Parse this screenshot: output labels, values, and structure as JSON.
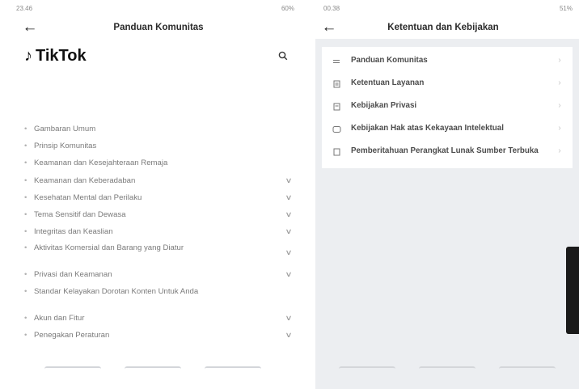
{
  "left": {
    "status": {
      "time": "23.46",
      "right": "60%"
    },
    "title": "Panduan Komunitas",
    "brand": "TikTok",
    "nav_items": [
      {
        "label": "Gambaran Umum",
        "expandable": false
      },
      {
        "label": "Prinsip Komunitas",
        "expandable": false
      },
      {
        "label": "Keamanan dan Kesejahteraan Remaja",
        "expandable": false
      },
      {
        "label": "Keamanan dan Keberadaban",
        "expandable": true
      },
      {
        "label": "Kesehatan Mental dan Perilaku",
        "expandable": true
      },
      {
        "label": "Tema Sensitif dan Dewasa",
        "expandable": true
      },
      {
        "label": "Integritas dan Keaslian",
        "expandable": true
      },
      {
        "label": "Aktivitas Komersial dan Barang yang Diatur",
        "expandable": true
      },
      {
        "label": "Privasi dan Keamanan",
        "expandable": true
      },
      {
        "label": "Standar Kelayakan Dorotan Konten Untuk Anda",
        "expandable": false
      },
      {
        "label": "Akun dan Fitur",
        "expandable": true
      },
      {
        "label": "Penegakan Peraturan",
        "expandable": true
      }
    ]
  },
  "right": {
    "status": {
      "time": "00.38",
      "right": "51%"
    },
    "title": "Ketentuan dan Kebijakan",
    "items": [
      {
        "label": "Panduan Komunitas",
        "icon": "flag-icon"
      },
      {
        "label": "Ketentuan Layanan",
        "icon": "document-icon"
      },
      {
        "label": "Kebijakan Privasi",
        "icon": "document-icon"
      },
      {
        "label": "Kebijakan Hak atas Kekayaan Intelektual",
        "icon": "copyright-icon"
      },
      {
        "label": "Pemberitahuan Perangkat Lunak Sumber Terbuka",
        "icon": "document-icon"
      }
    ]
  }
}
